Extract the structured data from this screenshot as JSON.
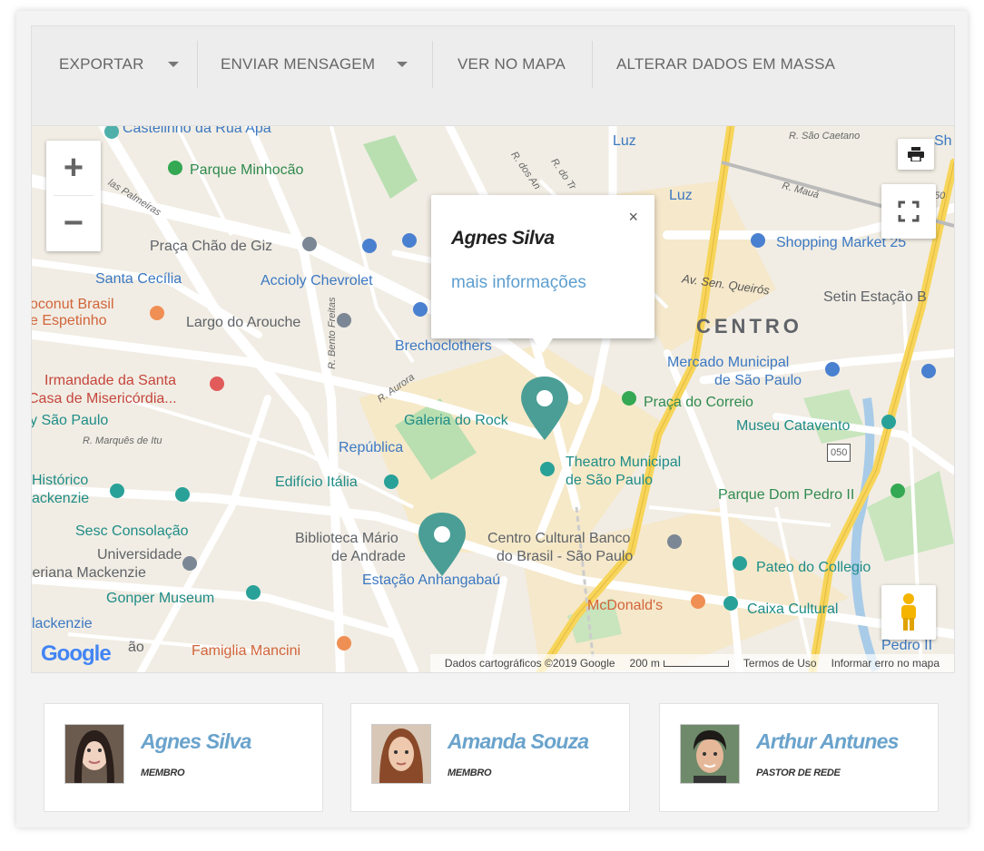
{
  "toolbar": {
    "export_label": "EXPORTAR",
    "send_message_label": "ENVIAR MENSAGEM",
    "view_map_label": "VER NO MAPA",
    "bulk_edit_label": "ALTERAR DADOS EM MASSA"
  },
  "map": {
    "labels": {
      "castelinho": "Castelinho da Rua Apa",
      "parque_minhocao": "Parque Minhocão",
      "praca_chao_giz": "Praça Chão de Giz",
      "santa_cecilia": "Santa Cecília",
      "accioly": "Accioly Chevrolet",
      "coconut_1": "oconut Brasil",
      "coconut_2": "e Espetinho",
      "largo_arouche": "Largo do Arouche",
      "brechoclothers": "Brechoclothers",
      "irmandade_1": "Irmandade da Santa",
      "irmandade_2": "Casa de Misericórdia...",
      "sao_paulo": "y São Paulo",
      "r_marques": "R. Marquês de Itu",
      "historico_1": "Histórico",
      "historico_2": "ackenzie",
      "sesc": "Sesc Consolação",
      "universidade_1": "Universidade",
      "universidade_2": "teriana Mackenzie",
      "gonper": "Gonper Museum",
      "mackenzie": "lackenzie",
      "galeria": "Galeria do Rock",
      "republica": "República",
      "edificio_italia": "Edifício Itália",
      "biblioteca_1": "Biblioteca Mário",
      "biblioteca_2": "de Andrade",
      "estacao": "Estação Anhangabaú",
      "famiglia": "Famiglia Mancini",
      "luz_1": "Luz",
      "luz_2": "Luz",
      "r_sao_caetano": "R. São Caetano",
      "r_maua": "R. Mauá",
      "shopping": "Shopping Market 25",
      "av_queiros": "Av. Sen. Queirós",
      "setin": "Setin Estação B",
      "centro": "CENTRO",
      "mercado_1": "Mercado Municipal",
      "mercado_2": "de São Paulo",
      "praca_correio": "Praça do Correio",
      "museu_catavento": "Museu Catavento",
      "theatro_1": "Theatro Municipal",
      "theatro_2": "de São Paulo",
      "parque_dom": "Parque Dom Pedro II",
      "ccbb_1": "Centro Cultural Banco",
      "ccbb_2": "do Brasil - São Paulo",
      "pateo": "Pateo do Collegio",
      "mcdonalds": "McDonald's",
      "caixa": "Caixa Cultural",
      "pedro": "Pedro II",
      "r_aurora": "R. Aurora",
      "r_bento": "R. Bento Freitas",
      "r_dos_an": "R. dos An",
      "r_do_tr": "R. do Tr",
      "route_050": "050",
      "sh": "Sh",
      "sh_50": "50",
      "palmeiras": "las Palmeiras",
      "cao": "ão"
    },
    "popup": {
      "title": "Agnes Silva",
      "link": "mais informações",
      "close": "×"
    },
    "attribution": {
      "data": "Dados cartográficos ©2019 Google",
      "scale": "200 m",
      "terms": "Termos de Uso",
      "report": "Informar erro no mapa"
    },
    "google_logo": "Google"
  },
  "members": [
    {
      "name": "Agnes Silva",
      "role": "MEMBRO"
    },
    {
      "name": "Amanda Souza",
      "role": "MEMBRO"
    },
    {
      "name": "Arthur Antunes",
      "role": "PASTOR DE REDE"
    }
  ],
  "colors": {
    "accent": "#6aa3cc",
    "marker": "#4a9e96",
    "link": "#5e9fcf"
  }
}
